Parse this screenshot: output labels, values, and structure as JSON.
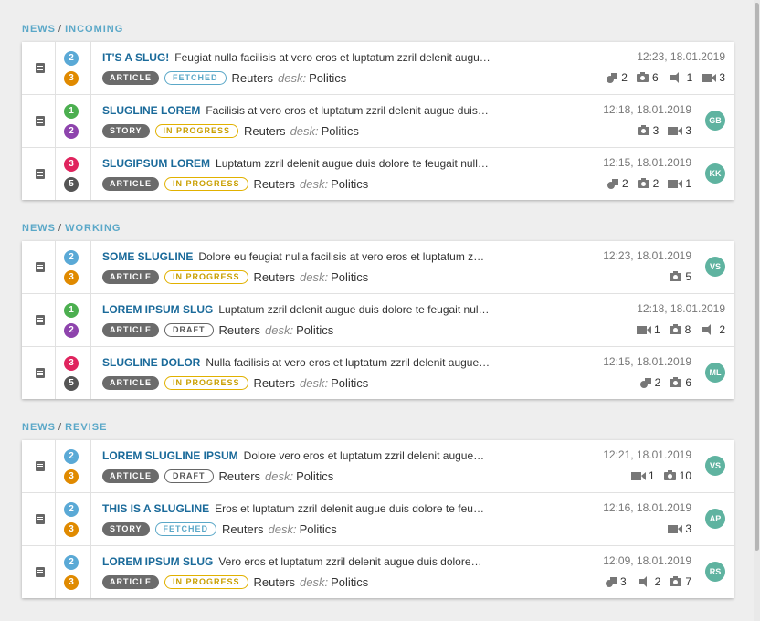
{
  "colors": {
    "priority": {
      "1": "#4caf50",
      "2": "#5aa9d6",
      "3": "#e0245e",
      "5": "#555555"
    },
    "urgency": {
      "2": "#8e44ad",
      "3": "#e08a00",
      "5": "#555555"
    },
    "avatar": "#5fb3a0",
    "accent": "#5ba8c8"
  },
  "groups": [
    {
      "desk": "NEWS",
      "stage": "INCOMING",
      "items": [
        {
          "priority": "2",
          "urgency": "3",
          "slug": "IT'S A SLUG!",
          "headline": "Feugiat nulla facilisis at vero eros et luptatum zzril delenit augu…",
          "type": "ARTICLE",
          "state": "FETCHED",
          "source": "Reuters",
          "desk_label": "desk:",
          "desk": "Politics",
          "datetime": "12:23, 18.01.2019",
          "stats": [
            {
              "icon": "related-icon",
              "count": "2"
            },
            {
              "icon": "photo-icon",
              "count": "6"
            },
            {
              "icon": "audio-icon",
              "count": "1"
            },
            {
              "icon": "video-icon",
              "count": "3"
            }
          ],
          "avatar": ""
        },
        {
          "priority": "1",
          "urgency": "2",
          "slug": "SLUGLINE LOREM",
          "headline": "Facilisis at vero eros et luptatum zzril delenit augue duis…",
          "type": "STORY",
          "state": "IN PROGRESS",
          "source": "Reuters",
          "desk_label": "desk:",
          "desk": "Politics",
          "datetime": "12:18, 18.01.2019",
          "stats": [
            {
              "icon": "photo-icon",
              "count": "3"
            },
            {
              "icon": "video-icon",
              "count": "3"
            }
          ],
          "avatar": "GB"
        },
        {
          "priority": "3",
          "urgency": "5",
          "slug": "SLUGIPSUM LOREM",
          "headline": "Luptatum zzril delenit augue duis dolore te feugait null…",
          "type": "ARTICLE",
          "state": "IN PROGRESS",
          "source": "Reuters",
          "desk_label": "desk:",
          "desk": "Politics",
          "datetime": "12:15, 18.01.2019",
          "stats": [
            {
              "icon": "related-icon",
              "count": "2"
            },
            {
              "icon": "photo-icon",
              "count": "2"
            },
            {
              "icon": "video-icon",
              "count": "1"
            }
          ],
          "avatar": "KK"
        }
      ]
    },
    {
      "desk": "NEWS",
      "stage": "WORKING",
      "items": [
        {
          "priority": "2",
          "urgency": "3",
          "slug": "SOME SLUGLINE",
          "headline": "Dolore eu feugiat nulla facilisis at vero eros et luptatum z…",
          "type": "ARTICLE",
          "state": "IN PROGRESS",
          "source": "Reuters",
          "desk_label": "desk:",
          "desk": "Politics",
          "datetime": "12:23, 18.01.2019",
          "stats": [
            {
              "icon": "photo-icon",
              "count": "5"
            }
          ],
          "avatar": "VS"
        },
        {
          "priority": "1",
          "urgency": "2",
          "slug": "LOREM IPSUM SLUG",
          "headline": "Luptatum zzril delenit augue duis dolore te feugait nul…",
          "type": "ARTICLE",
          "state": "DRAFT",
          "source": "Reuters",
          "desk_label": "desk:",
          "desk": "Politics",
          "datetime": "12:18, 18.01.2019",
          "stats": [
            {
              "icon": "video-icon",
              "count": "1"
            },
            {
              "icon": "photo-icon",
              "count": "8"
            },
            {
              "icon": "audio-icon",
              "count": "2"
            }
          ],
          "avatar": ""
        },
        {
          "priority": "3",
          "urgency": "5",
          "slug": "SLUGLINE DOLOR",
          "headline": "Nulla facilisis at vero eros et luptatum zzril delenit augue…",
          "type": "ARTICLE",
          "state": "IN PROGRESS",
          "source": "Reuters",
          "desk_label": "desk:",
          "desk": "Politics",
          "datetime": "12:15, 18.01.2019",
          "stats": [
            {
              "icon": "related-icon",
              "count": "2"
            },
            {
              "icon": "photo-icon",
              "count": "6"
            }
          ],
          "avatar": "ML"
        }
      ]
    },
    {
      "desk": "NEWS",
      "stage": "REVISE",
      "items": [
        {
          "priority": "2",
          "urgency": "3",
          "slug": "LOREM SLUGLINE IPSUM",
          "headline": "Dolore vero eros et luptatum zzril delenit augue…",
          "type": "ARTICLE",
          "state": "DRAFT",
          "source": "Reuters",
          "desk_label": "desk:",
          "desk": "Politics",
          "datetime": "12:21, 18.01.2019",
          "stats": [
            {
              "icon": "video-icon",
              "count": "1"
            },
            {
              "icon": "photo-icon",
              "count": "10"
            }
          ],
          "avatar": "VS"
        },
        {
          "priority": "2",
          "urgency": "3",
          "slug": "THIS IS A SLUGLINE",
          "headline": "Eros et luptatum zzril delenit augue duis dolore te feu…",
          "type": "STORY",
          "state": "FETCHED",
          "source": "Reuters",
          "desk_label": "desk:",
          "desk": "Politics",
          "datetime": "12:16, 18.01.2019",
          "stats": [
            {
              "icon": "video-icon",
              "count": "3"
            }
          ],
          "avatar": "AP"
        },
        {
          "priority": "2",
          "urgency": "3",
          "slug": "LOREM IPSUM SLUG",
          "headline": "Vero eros et luptatum zzril delenit augue duis dolore…",
          "type": "ARTICLE",
          "state": "IN PROGRESS",
          "source": "Reuters",
          "desk_label": "desk:",
          "desk": "Politics",
          "datetime": "12:09, 18.01.2019",
          "stats": [
            {
              "icon": "related-icon",
              "count": "3"
            },
            {
              "icon": "audio-icon",
              "count": "2"
            },
            {
              "icon": "photo-icon",
              "count": "7"
            }
          ],
          "avatar": "RS"
        }
      ]
    }
  ]
}
